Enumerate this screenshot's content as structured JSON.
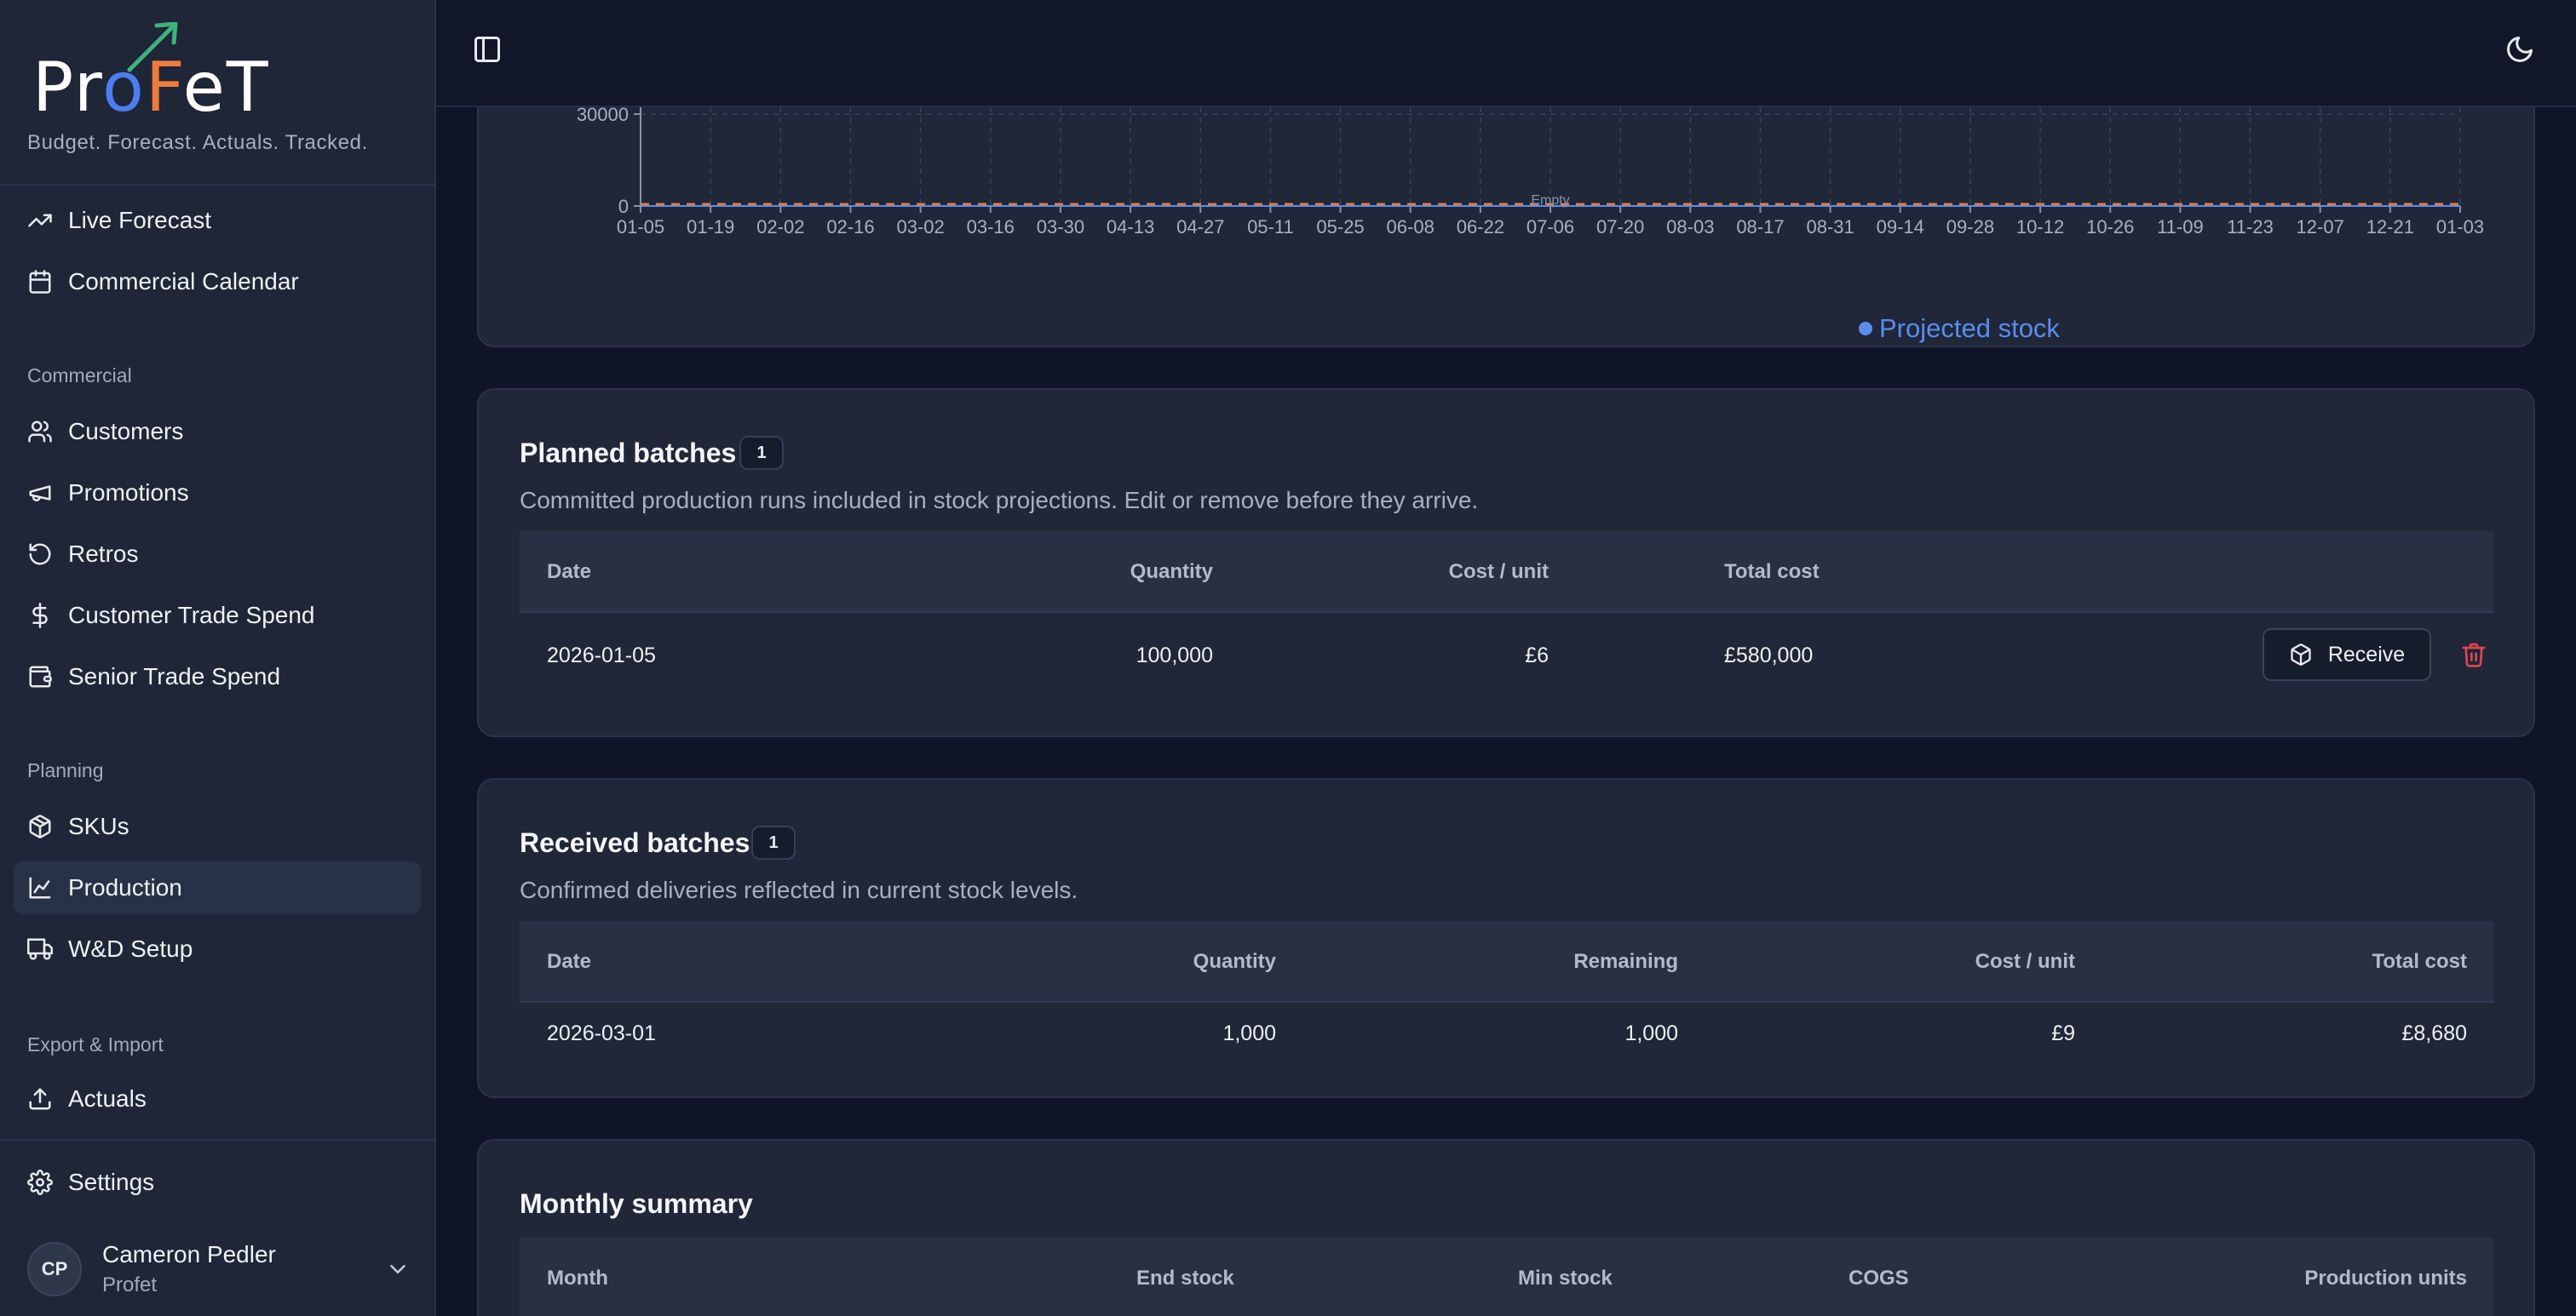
{
  "brand": {
    "logo_text": "ProFeT",
    "tagline": "Budget. Forecast. Actuals. Tracked."
  },
  "nav": {
    "top": [
      {
        "label": "Live Forecast",
        "icon": "trending-up-icon"
      },
      {
        "label": "Commercial Calendar",
        "icon": "calendar-icon"
      }
    ],
    "sections": [
      {
        "label": "Commercial",
        "items": [
          {
            "label": "Customers",
            "icon": "users-icon"
          },
          {
            "label": "Promotions",
            "icon": "megaphone-icon"
          },
          {
            "label": "Retros",
            "icon": "rotate-ccw-icon"
          },
          {
            "label": "Customer Trade Spend",
            "icon": "dollar-icon"
          },
          {
            "label": "Senior Trade Spend",
            "icon": "wallet-icon"
          }
        ]
      },
      {
        "label": "Planning",
        "items": [
          {
            "label": "SKUs",
            "icon": "package-icon"
          },
          {
            "label": "Production",
            "icon": "factory-icon",
            "active": true
          },
          {
            "label": "W&D Setup",
            "icon": "truck-icon"
          }
        ]
      },
      {
        "label": "Export & Import",
        "items": [
          {
            "label": "Actuals",
            "icon": "upload-icon"
          }
        ]
      }
    ],
    "settings": {
      "label": "Settings",
      "icon": "gear-icon"
    }
  },
  "user": {
    "initials": "CP",
    "name": "Cameron Pedler",
    "org": "Profet"
  },
  "chart_data": {
    "type": "line",
    "yticks": [
      "30000",
      "0"
    ],
    "ylim": [
      0,
      30000
    ],
    "categories": [
      "01-05",
      "01-19",
      "02-02",
      "02-16",
      "03-02",
      "03-16",
      "03-30",
      "04-13",
      "04-27",
      "05-11",
      "05-25",
      "06-08",
      "06-22",
      "07-06",
      "07-20",
      "08-03",
      "08-17",
      "08-31",
      "09-14",
      "09-28",
      "10-12",
      "10-26",
      "11-09",
      "11-23",
      "12-07",
      "12-21",
      "01-03"
    ],
    "series": [
      {
        "name": "Projected stock",
        "color": "#5b8def",
        "values": [
          0,
          0,
          0,
          0,
          0,
          0,
          0,
          0,
          0,
          0,
          0,
          0,
          0,
          0,
          0,
          0,
          0,
          0,
          0,
          0,
          0,
          0,
          0,
          0,
          0,
          0,
          0
        ]
      }
    ],
    "reference_line_color": "#ef7b3b",
    "annotation": "Empty",
    "legend": "bottom-center"
  },
  "planned": {
    "title": "Planned batches",
    "count": "1",
    "description": "Committed production runs included in stock projections. Edit or remove before they arrive.",
    "headers": {
      "date": "Date",
      "quantity": "Quantity",
      "cost_unit": "Cost / unit",
      "total_cost": "Total cost"
    },
    "rows": [
      {
        "date": "2026-01-05",
        "quantity": "100,000",
        "cost_unit": "£6",
        "total_cost": "£580,000",
        "action": "Receive"
      }
    ]
  },
  "received": {
    "title": "Received batches",
    "count": "1",
    "description": "Confirmed deliveries reflected in current stock levels.",
    "headers": {
      "date": "Date",
      "quantity": "Quantity",
      "remaining": "Remaining",
      "cost_unit": "Cost / unit",
      "total_cost": "Total cost"
    },
    "rows": [
      {
        "date": "2026-03-01",
        "quantity": "1,000",
        "remaining": "1,000",
        "cost_unit": "£9",
        "total_cost": "£8,680"
      }
    ]
  },
  "monthly": {
    "title": "Monthly summary",
    "headers": {
      "month": "Month",
      "end_stock": "End stock",
      "min_stock": "Min stock",
      "cogs": "COGS",
      "production_units": "Production units"
    }
  }
}
